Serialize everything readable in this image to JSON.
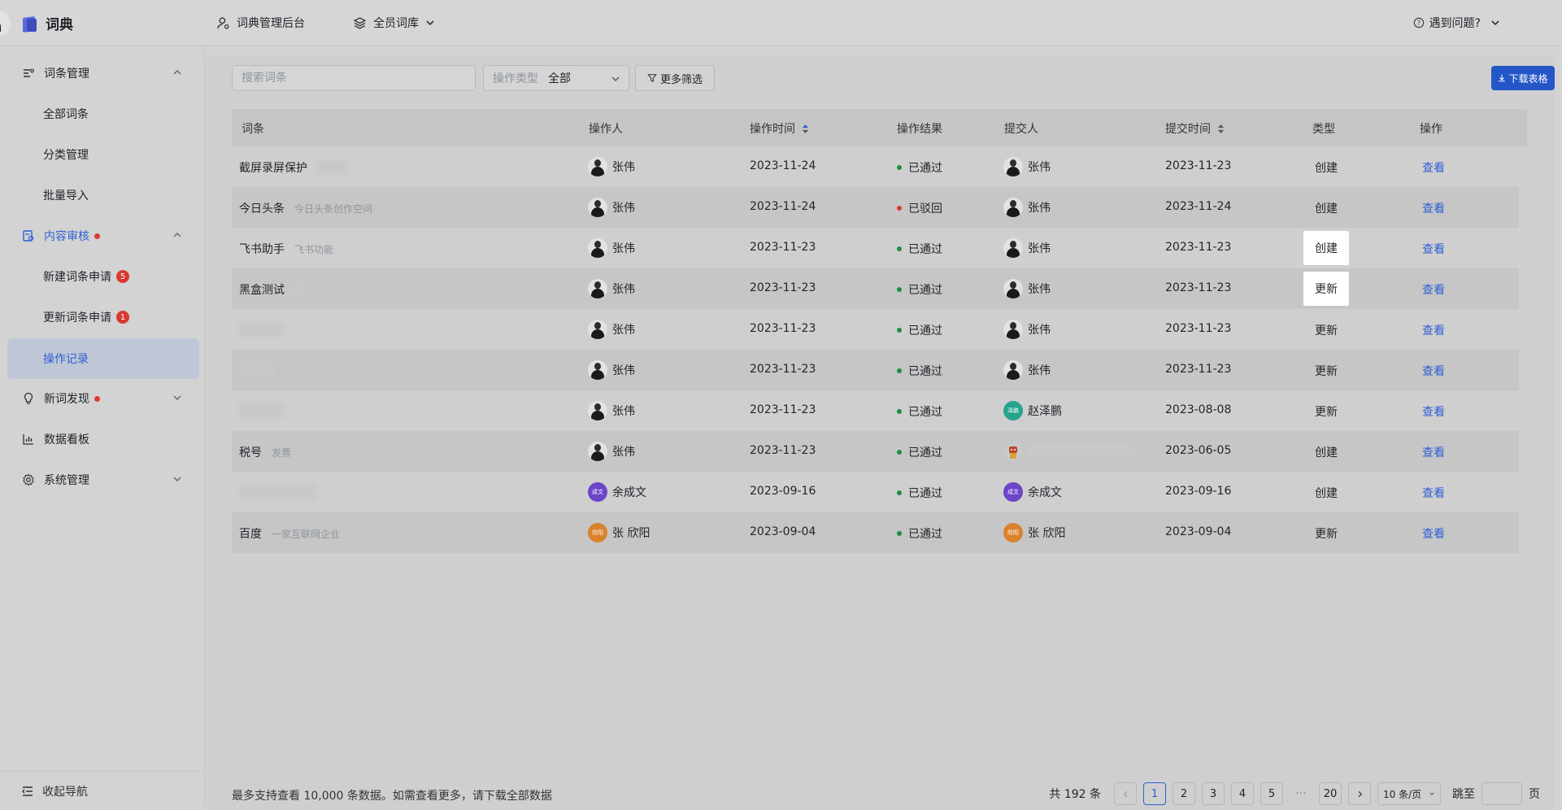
{
  "app": {
    "title": "词典"
  },
  "topbar": {
    "nav1": "词典管理后台",
    "nav2": "全员词库",
    "help": "遇到问题?"
  },
  "sidebar": {
    "groups": [
      {
        "label": "词条管理",
        "icon": "list-filter-icon"
      },
      {
        "label": "内容审核",
        "icon": "audit-icon"
      },
      {
        "label": "新词发现",
        "icon": "bulb-icon"
      },
      {
        "label": "数据看板",
        "icon": "bar-chart-icon"
      },
      {
        "label": "系统管理",
        "icon": "gear-icon"
      }
    ],
    "items": [
      {
        "label": "全部词条"
      },
      {
        "label": "分类管理"
      },
      {
        "label": "批量导入"
      },
      {
        "label": "新建词条申请",
        "badge": "5"
      },
      {
        "label": "更新词条申请",
        "badge": "1"
      },
      {
        "label": "操作记录"
      }
    ],
    "collapse": "收起导航"
  },
  "filters": {
    "search_placeholder": "搜索词条",
    "op_type_label": "操作类型",
    "op_type_value": "全部",
    "more": "更多筛选",
    "download": "下载表格"
  },
  "table": {
    "headers": [
      "词条",
      "操作人",
      "操作时间",
      "操作结果",
      "提交人",
      "提交时间",
      "类型",
      "操作"
    ],
    "rows": [
      {
        "word": "截屏录屏保护",
        "desc": "",
        "operator": "张伟",
        "op_time": "2023-11-24",
        "result": "已通过",
        "submitter": "张伟",
        "sub_time": "2023-11-23",
        "type": "创建",
        "action": "查看"
      },
      {
        "word": "今日头条",
        "desc": "今日头条创作空间",
        "operator": "张伟",
        "op_time": "2023-11-24",
        "result": "已驳回",
        "submitter": "张伟",
        "sub_time": "2023-11-24",
        "type": "创建",
        "action": "查看"
      },
      {
        "word": "飞书助手",
        "desc": "飞书功能",
        "operator": "张伟",
        "op_time": "2023-11-23",
        "result": "已通过",
        "submitter": "张伟",
        "sub_time": "2023-11-23",
        "type": "创建",
        "action": "查看"
      },
      {
        "word": "黑盒测试",
        "desc": "",
        "operator": "张伟",
        "op_time": "2023-11-23",
        "result": "已通过",
        "submitter": "张伟",
        "sub_time": "2023-11-23",
        "type": "更新",
        "action": "查看"
      },
      {
        "word": "",
        "desc": "",
        "operator": "张伟",
        "op_time": "2023-11-23",
        "result": "已通过",
        "submitter": "张伟",
        "sub_time": "2023-11-23",
        "type": "更新",
        "action": "查看"
      },
      {
        "word": "",
        "desc": "",
        "operator": "张伟",
        "op_time": "2023-11-23",
        "result": "已通过",
        "submitter": "张伟",
        "sub_time": "2023-11-23",
        "type": "更新",
        "action": "查看"
      },
      {
        "word": "",
        "desc": "",
        "operator": "张伟",
        "op_time": "2023-11-23",
        "result": "已通过",
        "submitter": "赵泽鹏",
        "submitter_avatar": "泽鹏",
        "sub_time": "2023-08-08",
        "type": "更新",
        "action": "查看"
      },
      {
        "word": "税号",
        "desc": "发票",
        "operator": "张伟",
        "op_time": "2023-11-23",
        "result": "已通过",
        "submitter": "",
        "sub_time": "2023-06-05",
        "type": "创建",
        "action": "查看"
      },
      {
        "word": "",
        "desc": "",
        "operator": "余成文",
        "operator_avatar": "成文",
        "op_time": "2023-09-16",
        "result": "已通过",
        "submitter": "余成文",
        "submitter_avatar": "成文",
        "sub_time": "2023-09-16",
        "type": "创建",
        "action": "查看"
      },
      {
        "word": "百度",
        "desc": "一家互联网企业",
        "operator": "张 欣阳",
        "operator_avatar": "欣阳",
        "op_time": "2023-09-04",
        "result": "已通过",
        "submitter": "张 欣阳",
        "submitter_avatar": "欣阳",
        "sub_time": "2023-09-04",
        "type": "更新",
        "action": "查看"
      }
    ]
  },
  "footer": {
    "note": "最多支持查看 10,000 条数据。如需查看更多，请下载全部数据",
    "total": "共 192 条",
    "pages": [
      "1",
      "2",
      "3",
      "4",
      "5"
    ],
    "ellipsis": "···",
    "last_page": "20",
    "page_size": "10 条/页",
    "jump_label": "跳至",
    "page_unit": "页"
  },
  "colors": {
    "accent": "#2e5fd6",
    "pass": "#1a8f3f",
    "reject": "#d83931"
  }
}
